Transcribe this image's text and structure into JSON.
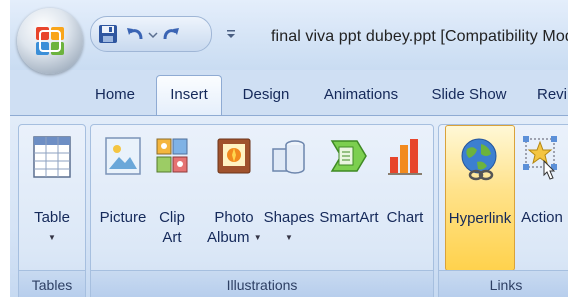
{
  "qat": {
    "items": [
      "save-icon",
      "undo-icon",
      "dropdown-arrow-icon",
      "redo-icon"
    ],
    "customize_icon": "customize-qat-icon"
  },
  "window": {
    "title": "final viva ppt dubey.ppt [Compatibility Mode]"
  },
  "tabs": [
    {
      "label": "Home",
      "active": false
    },
    {
      "label": "Insert",
      "active": true
    },
    {
      "label": "Design",
      "active": false
    },
    {
      "label": "Animations",
      "active": false
    },
    {
      "label": "Slide Show",
      "active": false
    },
    {
      "label": "Revi",
      "active": false
    }
  ],
  "groups": {
    "tables": {
      "label": "Tables",
      "buttons": [
        {
          "icon": "table-icon",
          "lines": [
            "Table"
          ],
          "dropdown": true
        }
      ]
    },
    "illustrations": {
      "label": "Illustrations",
      "buttons": [
        {
          "icon": "picture-icon",
          "lines": [
            "Picture"
          ]
        },
        {
          "icon": "clip-art-icon",
          "lines": [
            "Clip",
            "Art"
          ]
        },
        {
          "icon": "photo-album-icon",
          "lines": [
            "Photo",
            "Album"
          ],
          "dropdown": true
        },
        {
          "icon": "shapes-icon",
          "lines": [
            "Shapes"
          ],
          "dropdown": true
        },
        {
          "icon": "smartart-icon",
          "lines": [
            "SmartArt"
          ]
        },
        {
          "icon": "chart-icon",
          "lines": [
            "Chart"
          ]
        }
      ]
    },
    "links": {
      "label": "Links",
      "buttons": [
        {
          "icon": "hyperlink-icon",
          "lines": [
            "Hyperlink"
          ],
          "highlighted": true
        },
        {
          "icon": "action-icon",
          "lines": [
            "Action"
          ]
        }
      ]
    }
  },
  "colors": {
    "ribbon": "#d6e4f6",
    "tab_text": "#15295a",
    "highlight": "#ffd24d"
  }
}
